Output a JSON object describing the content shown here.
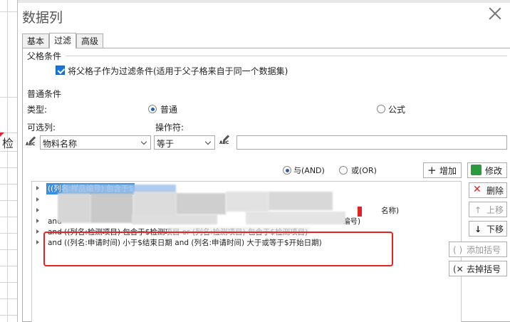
{
  "background": {
    "cell_text": "检"
  },
  "dialog": {
    "title": "数据列",
    "tabs": [
      {
        "label": "基本"
      },
      {
        "label": "过滤"
      },
      {
        "label": "高级"
      }
    ],
    "parent_section": {
      "label": "父格条件",
      "checkbox_label": "将父格子作为过滤条件(适用于父子格来自于同一个数据集)",
      "checked": true
    },
    "normal_section": {
      "label": "普通条件",
      "type_label": "类型:",
      "type_options": [
        {
          "label": "普通",
          "selected": true
        },
        {
          "label": "公式",
          "selected": false
        }
      ],
      "column_label": "可选列:",
      "column_value": "物料名称",
      "operator_label": "操作符:",
      "operator_value": "等于",
      "value_input": ""
    },
    "logic": {
      "and_label": "与(AND)",
      "or_label": "或(OR)",
      "selected": "and"
    },
    "buttons": {
      "add": "增加",
      "edit": "修改",
      "delete": "删除",
      "up": "上移",
      "down": "下移",
      "add_bracket": "添加括号",
      "remove_bracket": "去掉括号"
    },
    "conditions": [
      {
        "text": "((列名:样品编号) 包含于$",
        "selected": true,
        "blurred": true
      },
      {
        "text": "",
        "blurred": true
      },
      {
        "text": "名称)",
        "blurred": true
      },
      {
        "text": "and ",
        "tail": "编号)",
        "blurred": true
      },
      {
        "text": "and ((列名:检测项目) 包含于$检测项目 or (列名:检测项目) 包含于$检测项目)",
        "blurred": true
      },
      {
        "text": "and ((列名:申请时间) 小于$结束日期 and (列名:申请时间) 大于或等于$开始日期)",
        "blurred": false
      }
    ],
    "colors": {
      "accent": "#1e74d6",
      "highlight": "#e52222",
      "selection": "#3b8fe0"
    }
  }
}
